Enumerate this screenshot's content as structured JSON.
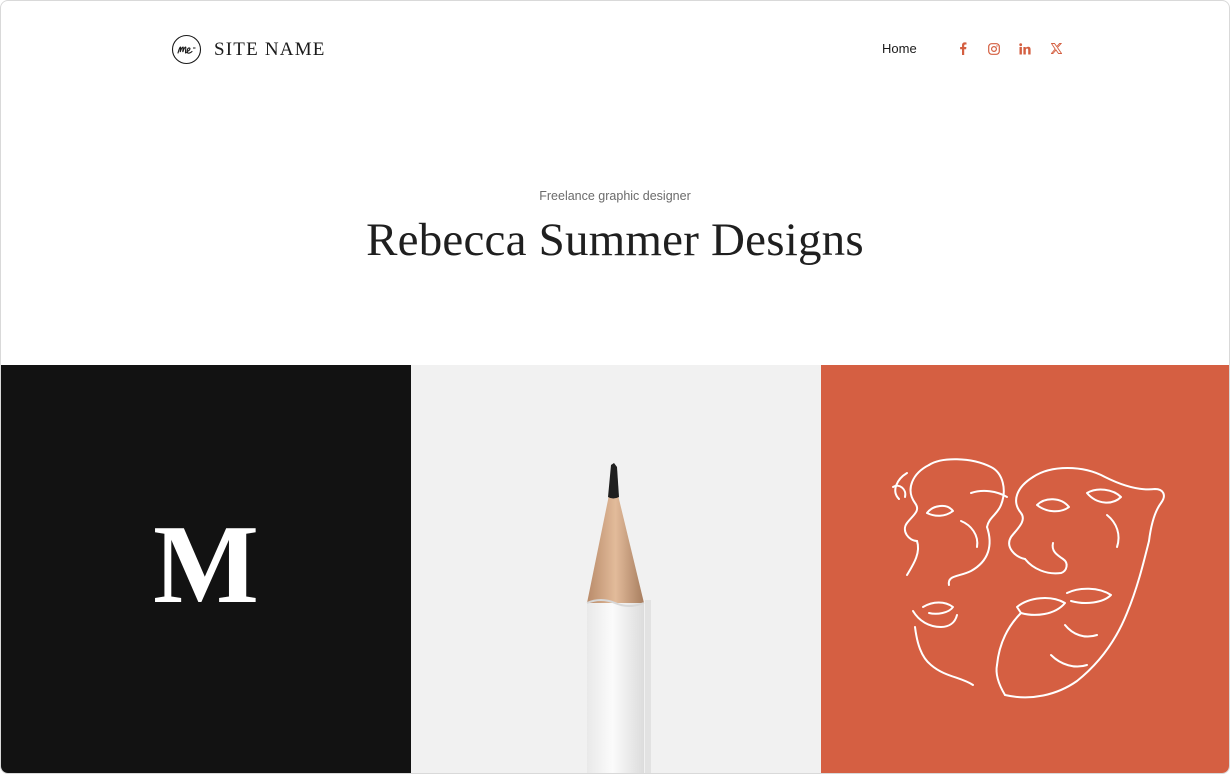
{
  "header": {
    "site_name": "SITE NAME",
    "logo_icon": "me-monogram-icon",
    "nav": [
      {
        "label": "Home"
      }
    ],
    "socials": [
      {
        "name": "facebook-icon"
      },
      {
        "name": "instagram-icon"
      },
      {
        "name": "linkedin-icon"
      },
      {
        "name": "x-icon"
      }
    ]
  },
  "hero": {
    "subtitle": "Freelance graphic designer",
    "title": "Rebecca Summer Designs"
  },
  "tiles": [
    {
      "name": "monogram-tile",
      "letter": "M",
      "background": "#121212"
    },
    {
      "name": "pencil-tile",
      "background": "#f1f1f1"
    },
    {
      "name": "line-face-tile",
      "background": "#d55f42"
    }
  ],
  "colors": {
    "accent": "#d45f41",
    "text": "#1f1f1f",
    "muted": "#6b6b6b"
  }
}
